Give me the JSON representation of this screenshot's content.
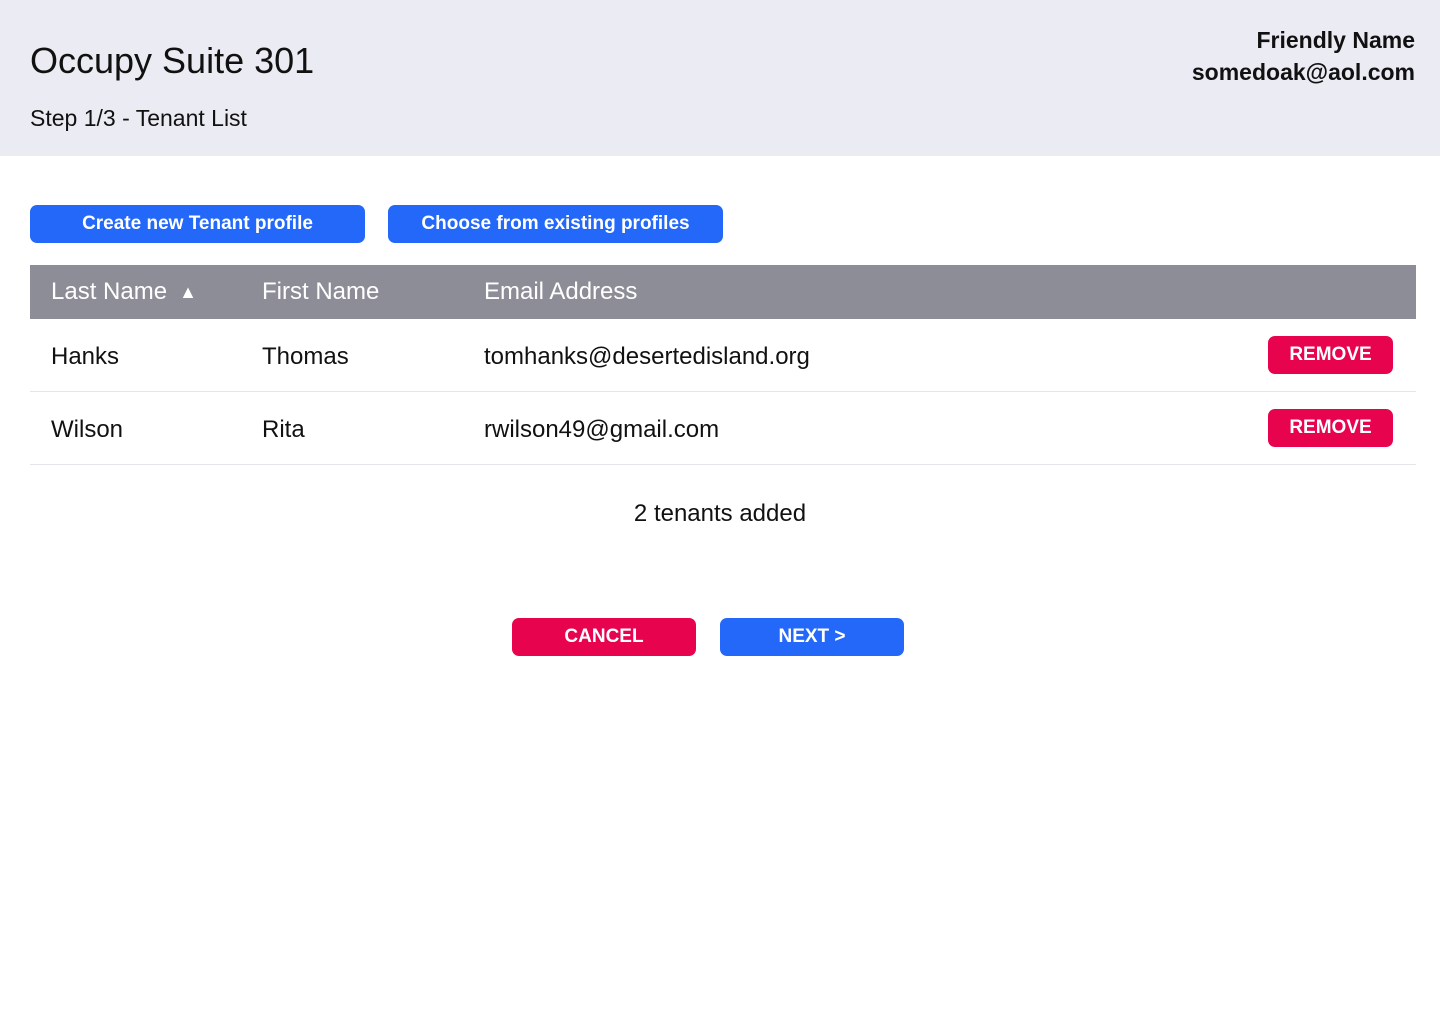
{
  "header": {
    "title": "Occupy Suite 301",
    "step": "Step 1/3 - Tenant List",
    "user_name": "Friendly Name",
    "user_email": "somedoak@aol.com"
  },
  "actions": {
    "create_label": "Create new Tenant profile",
    "existing_label": "Choose from existing profiles"
  },
  "table": {
    "columns": [
      "Last Name",
      "First Name",
      "Email Address"
    ],
    "sort_icon": "sort-ascending-icon",
    "rows": [
      {
        "last": "Hanks",
        "first": "Thomas",
        "email": "tomhanks@desertedisland.org",
        "remove_label": "REMOVE"
      },
      {
        "last": "Wilson",
        "first": "Rita",
        "email": "rwilson49@gmail.com",
        "remove_label": "REMOVE"
      }
    ]
  },
  "summary": "2 tenants added",
  "footer": {
    "cancel_label": "CANCEL",
    "next_label": "NEXT >"
  },
  "colors": {
    "header_bg": "#ebecf3",
    "primary": "#2468fa",
    "danger": "#e8034f",
    "table_header": "#8d8d98"
  }
}
